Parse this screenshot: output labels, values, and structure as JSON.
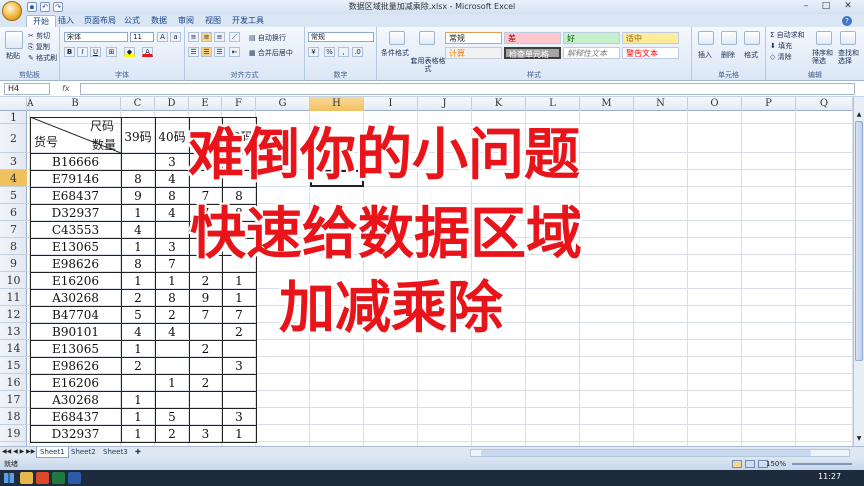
{
  "window": {
    "title": "数据区域批量加减乘除.xlsx - Microsoft Excel"
  },
  "menu": {
    "tabs": [
      "开始",
      "插入",
      "页面布局",
      "公式",
      "数据",
      "审阅",
      "视图",
      "开发工具"
    ]
  },
  "ribbon": {
    "clipboard": {
      "paste": "粘贴",
      "cut": "剪切",
      "copy": "复制",
      "format_painter": "格式刷",
      "label": "剪贴板"
    },
    "font": {
      "name": "宋体",
      "size": "11",
      "label": "字体"
    },
    "alignment": {
      "wrap": "自动换行",
      "merge": "合并后居中",
      "label": "对齐方式"
    },
    "number": {
      "format": "常规",
      "label": "数字"
    },
    "styles": {
      "cond_format": "条件格式",
      "table_format": "套用表格格式",
      "label": "样式",
      "items": [
        {
          "text": "常规",
          "bg": "#ffffff",
          "color": "#000000"
        },
        {
          "text": "差",
          "bg": "#ffc7ce",
          "color": "#9c0006"
        },
        {
          "text": "好",
          "bg": "#c6efce",
          "color": "#006100"
        },
        {
          "text": "适中",
          "bg": "#ffeb9c",
          "color": "#9c6500"
        },
        {
          "text": "计算",
          "bg": "#f2f2f2",
          "color": "#fa7d00"
        },
        {
          "text": "检查单元格",
          "bg": "#a5a5a5",
          "color": "#ffffff"
        },
        {
          "text": "解释性文本",
          "bg": "#ffffff",
          "color": "#7f7f7f"
        },
        {
          "text": "警告文本",
          "bg": "#ffffff",
          "color": "#ff0000"
        }
      ]
    },
    "cells": {
      "insert": "插入",
      "delete": "删除",
      "format": "格式",
      "label": "单元格"
    },
    "editing": {
      "autosum": "自动求和",
      "fill": "填充",
      "clear": "清除",
      "sort": "排序和筛选",
      "find": "查找和选择",
      "label": "编辑"
    }
  },
  "formula_bar": {
    "cell_ref": "H4",
    "fx": "fx",
    "content": ""
  },
  "columns": [
    "A",
    "B",
    "C",
    "D",
    "E",
    "F",
    "G",
    "H",
    "I",
    "J",
    "K",
    "L",
    "M",
    "N",
    "O",
    "P",
    "Q"
  ],
  "rows": [
    "1",
    "2",
    "3",
    "4",
    "5",
    "6",
    "7",
    "8",
    "9",
    "10",
    "11",
    "12",
    "13",
    "14",
    "15",
    "16",
    "17",
    "18",
    "19",
    "20"
  ],
  "table": {
    "header": {
      "size": "尺码",
      "qty": "数量",
      "code": "货号",
      "c39": "39码",
      "c40": "40码",
      "c41": "41码",
      "c42": "42码"
    },
    "rows": [
      {
        "code": "B16666",
        "c39": "",
        "c40": "3",
        "c41": "",
        "c42": ""
      },
      {
        "code": "E79146",
        "c39": "8",
        "c40": "4",
        "c41": "",
        "c42": ""
      },
      {
        "code": "E68437",
        "c39": "9",
        "c40": "8",
        "c41": "7",
        "c42": "8"
      },
      {
        "code": "D32937",
        "c39": "1",
        "c40": "4",
        "c41": "7",
        "c42": "8"
      },
      {
        "code": "C43553",
        "c39": "4",
        "c40": "",
        "c41": "",
        "c42": ""
      },
      {
        "code": "E13065",
        "c39": "1",
        "c40": "3",
        "c41": "",
        "c42": ""
      },
      {
        "code": "E98626",
        "c39": "8",
        "c40": "7",
        "c41": "",
        "c42": ""
      },
      {
        "code": "E16206",
        "c39": "1",
        "c40": "1",
        "c41": "2",
        "c42": "1"
      },
      {
        "code": "A30268",
        "c39": "2",
        "c40": "8",
        "c41": "9",
        "c42": "1"
      },
      {
        "code": "B47704",
        "c39": "5",
        "c40": "2",
        "c41": "7",
        "c42": "7"
      },
      {
        "code": "B90101",
        "c39": "4",
        "c40": "4",
        "c41": "",
        "c42": "2"
      },
      {
        "code": "E13065",
        "c39": "1",
        "c40": "",
        "c41": "2",
        "c42": ""
      },
      {
        "code": "E98626",
        "c39": "2",
        "c40": "",
        "c41": "",
        "c42": "3"
      },
      {
        "code": "E16206",
        "c39": "",
        "c40": "1",
        "c41": "2",
        "c42": ""
      },
      {
        "code": "A30268",
        "c39": "1",
        "c40": "",
        "c41": "",
        "c42": ""
      },
      {
        "code": "E68437",
        "c39": "1",
        "c40": "5",
        "c41": "",
        "c42": "3"
      },
      {
        "code": "D32937",
        "c39": "1",
        "c40": "2",
        "c41": "3",
        "c42": "1"
      }
    ]
  },
  "overlay": {
    "line1": "难倒你的小问题",
    "line2": "快速给数据区域",
    "line3": "加减乘除",
    "color": "#e8141a"
  },
  "sheets": [
    "Sheet1",
    "Sheet2",
    "Sheet3"
  ],
  "status": {
    "ready": "就绪",
    "zoom": "150%"
  },
  "taskbar": {
    "time": "11:27"
  }
}
